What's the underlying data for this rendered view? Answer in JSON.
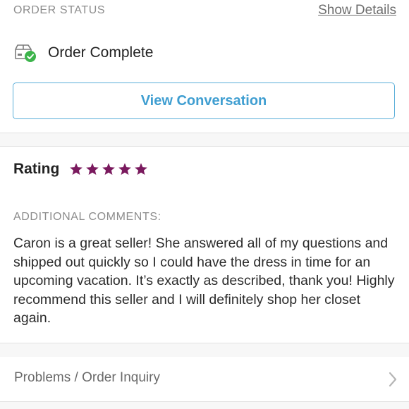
{
  "order_status": {
    "heading": "ORDER STATUS",
    "show_details_label": "Show Details",
    "status_icon": "package-check-icon",
    "status_text": "Order Complete",
    "view_conversation_label": "View Conversation"
  },
  "rating": {
    "label": "Rating",
    "stars": 5,
    "max_stars": 5,
    "star_color": "#7a1a5e"
  },
  "comments": {
    "heading": "ADDITIONAL COMMENTS:",
    "text": "Caron is a great seller! She answered all of my questions and shipped out quickly so I could have the dress in time for an upcoming vacation. It’s exactly as described, thank you! Highly recommend this seller and I will definitely shop her closet again."
  },
  "inquiry": {
    "label": "Problems / Order Inquiry",
    "icon": "chevron-right-icon"
  },
  "colors": {
    "accent_blue": "#3f9ed1",
    "success_green": "#3cb44b",
    "heading_gray": "#8c8c8c"
  }
}
